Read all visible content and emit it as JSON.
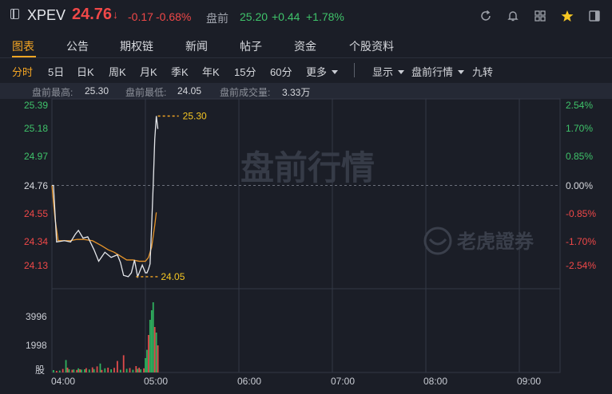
{
  "header": {
    "symbol": "XPEV",
    "price": "24.76",
    "price_arrow": "↓",
    "change": "-0.17",
    "change_pct": "-0.68%",
    "premarket_label": "盘前",
    "premarket_price": "25.20",
    "premarket_change": "+0.44",
    "premarket_change_pct": "+1.78%",
    "colors": {
      "down": "#f04848",
      "up": "#3fc36a",
      "accent": "#f5a623"
    }
  },
  "tabs": [
    "图表",
    "公告",
    "期权链",
    "新闻",
    "帖子",
    "资金",
    "个股资料"
  ],
  "timeframes": [
    "分时",
    "5日",
    "日K",
    "周K",
    "月K",
    "季K",
    "年K",
    "15分",
    "60分"
  ],
  "more_label": "更多",
  "display_label": "显示",
  "session_label": "盘前行情",
  "adjust_label": "九转",
  "stats": [
    {
      "label": "盘前最高:",
      "value": "25.30"
    },
    {
      "label": "盘前最低:",
      "value": "24.05"
    },
    {
      "label": "盘前成交量:",
      "value": "3.33万"
    }
  ],
  "watermark": "盘前行情",
  "logo_text": "老虎證券",
  "chart_data": {
    "type": "line",
    "price_axis": [
      "25.39",
      "25.18",
      "24.97",
      "24.76",
      "24.55",
      "24.34",
      "24.13"
    ],
    "pct_axis": [
      "2.54%",
      "1.70%",
      "0.85%",
      "0.00%",
      "-0.85%",
      "-1.70%",
      "-2.54%"
    ],
    "volume_axis": [
      "3996",
      "1998",
      "股"
    ],
    "x_ticks": [
      "04:00",
      "05:00",
      "06:00",
      "07:00",
      "08:00",
      "09:00"
    ],
    "prev_close": 24.76,
    "high_marker": "25.30",
    "low_marker": "24.05",
    "ylim": [
      24.13,
      25.39
    ],
    "price": [
      [
        0,
        24.76
      ],
      [
        1,
        24.76
      ],
      [
        3,
        24.32
      ],
      [
        8,
        24.33
      ],
      [
        12,
        24.32
      ],
      [
        15,
        24.38
      ],
      [
        17,
        24.41
      ],
      [
        20,
        24.35
      ],
      [
        23,
        24.36
      ],
      [
        27,
        24.26
      ],
      [
        30,
        24.17
      ],
      [
        34,
        24.24
      ],
      [
        38,
        24.2
      ],
      [
        42,
        24.22
      ],
      [
        44,
        24.16
      ],
      [
        46,
        24.06
      ],
      [
        49,
        24.05
      ],
      [
        51,
        24.08
      ],
      [
        53,
        24.18
      ],
      [
        55,
        24.05
      ],
      [
        58,
        24.14
      ],
      [
        60,
        24.08
      ],
      [
        61,
        24.08
      ],
      [
        62,
        24.11
      ],
      [
        63,
        24.15
      ],
      [
        64,
        24.45
      ],
      [
        65,
        24.76
      ],
      [
        66,
        25.12
      ],
      [
        67,
        25.3
      ],
      [
        68,
        25.2
      ]
    ],
    "avg_price": [
      [
        0,
        24.76
      ],
      [
        2,
        24.5
      ],
      [
        4,
        24.33
      ],
      [
        8,
        24.33
      ],
      [
        12,
        24.33
      ],
      [
        16,
        24.34
      ],
      [
        20,
        24.34
      ],
      [
        26,
        24.33
      ],
      [
        32,
        24.29
      ],
      [
        36,
        24.26
      ],
      [
        40,
        24.24
      ],
      [
        44,
        24.21
      ],
      [
        48,
        24.18
      ],
      [
        52,
        24.18
      ],
      [
        56,
        24.17
      ],
      [
        60,
        24.17
      ],
      [
        62,
        24.2
      ],
      [
        64,
        24.28
      ],
      [
        66,
        24.45
      ],
      [
        67,
        24.55
      ]
    ],
    "volume_max": 4600,
    "volume": [
      [
        1,
        0,
        150
      ],
      [
        3,
        1,
        100
      ],
      [
        5,
        0,
        120
      ],
      [
        7,
        1,
        220
      ],
      [
        9,
        0,
        780
      ],
      [
        10,
        1,
        300
      ],
      [
        11,
        0,
        200
      ],
      [
        13,
        1,
        170
      ],
      [
        14,
        0,
        190
      ],
      [
        16,
        1,
        160
      ],
      [
        17,
        0,
        260
      ],
      [
        18,
        1,
        200
      ],
      [
        19,
        0,
        180
      ],
      [
        21,
        0,
        200
      ],
      [
        22,
        1,
        270
      ],
      [
        24,
        0,
        190
      ],
      [
        26,
        1,
        320
      ],
      [
        27,
        0,
        210
      ],
      [
        29,
        1,
        380
      ],
      [
        31,
        0,
        560
      ],
      [
        32,
        1,
        160
      ],
      [
        34,
        0,
        260
      ],
      [
        36,
        1,
        300
      ],
      [
        38,
        0,
        200
      ],
      [
        40,
        1,
        290
      ],
      [
        42,
        1,
        720
      ],
      [
        44,
        0,
        170
      ],
      [
        46,
        1,
        1080
      ],
      [
        48,
        0,
        230
      ],
      [
        50,
        1,
        280
      ],
      [
        52,
        0,
        170
      ],
      [
        54,
        1,
        400
      ],
      [
        55,
        0,
        230
      ],
      [
        56,
        1,
        300
      ],
      [
        57,
        0,
        200
      ],
      [
        59,
        1,
        260
      ],
      [
        60,
        0,
        900
      ],
      [
        61,
        0,
        1420
      ],
      [
        62,
        1,
        2350
      ],
      [
        63,
        0,
        3300
      ],
      [
        64,
        0,
        3900
      ],
      [
        65,
        0,
        4400
      ],
      [
        66,
        1,
        2850
      ],
      [
        67,
        0,
        2500
      ],
      [
        68,
        1,
        1700
      ]
    ]
  }
}
